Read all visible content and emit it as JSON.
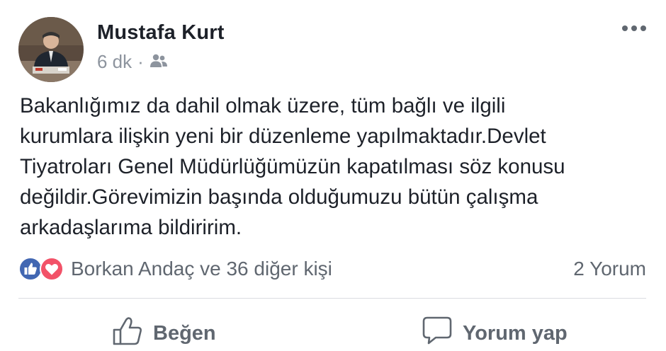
{
  "post": {
    "author": "Mustafa Kurt",
    "time": "6 dk",
    "separator": "·",
    "audience_icon": "friends-icon",
    "text": "Bakanlığımız da dahil olmak üzere, tüm bağlı ve ilgili\nkurumlara ilişkin yeni bir düzenleme yapılmaktadır.Devlet\nTiyatroları Genel Müdürlüğümüzün kapatılması söz konusu\ndeğildir.Görevimizin başında olduğumuzu bütün çalışma\narkadaşlarıma bildiririm."
  },
  "reactions": {
    "icons": [
      "like-icon",
      "love-icon"
    ],
    "text": "Borkan Andaç ve 36 diğer kişi",
    "comments": "2 Yorum",
    "colors": {
      "like": "#4267b2",
      "love": "#f25268"
    }
  },
  "actions": {
    "like_label": "Beğen",
    "comment_label": "Yorum yap"
  }
}
